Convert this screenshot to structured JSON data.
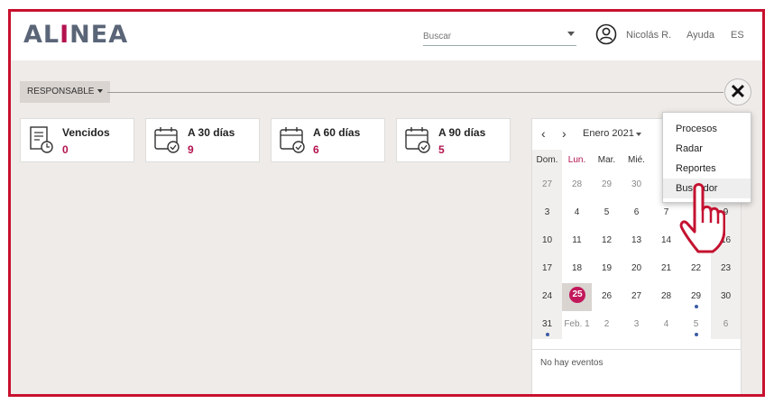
{
  "header": {
    "logo": {
      "part1": "AL",
      "part2": "I",
      "part3": "NEA"
    },
    "search_placeholder": "Buscar",
    "user_name": "Nicolás R.",
    "help": "Ayuda",
    "language": "ES"
  },
  "filter": {
    "label": "RESPONSABLE"
  },
  "close_label": "✕",
  "cards": [
    {
      "title": "Vencidos",
      "count": "0"
    },
    {
      "title": "A 30 días",
      "count": "9"
    },
    {
      "title": "A 60 días",
      "count": "6"
    },
    {
      "title": "A 90 días",
      "count": "5"
    }
  ],
  "calendar": {
    "prev": "‹",
    "next": "›",
    "month": "Enero 2021",
    "weekdays": [
      "Dom.",
      "Lun.",
      "Mar.",
      "Mié.",
      "",
      "",
      ""
    ],
    "weeks": [
      [
        "27",
        "28",
        "29",
        "30",
        "",
        "",
        ""
      ],
      [
        "3",
        "4",
        "5",
        "6",
        "7",
        "",
        "9"
      ],
      [
        "10",
        "11",
        "12",
        "13",
        "14",
        "",
        "16"
      ],
      [
        "17",
        "18",
        "19",
        "20",
        "21",
        "22",
        "23"
      ],
      [
        "24",
        "25",
        "26",
        "27",
        "28",
        "29",
        "30"
      ],
      [
        "31",
        "Feb. 1",
        "2",
        "3",
        "4",
        "5",
        "6"
      ]
    ],
    "today": "25",
    "no_events": "No hay eventos"
  },
  "menu": {
    "items": [
      "Procesos",
      "Radar",
      "Reportes",
      "Buscador"
    ],
    "active": "Buscador"
  },
  "colors": {
    "accent": "#b3124f",
    "frame": "#c8102e",
    "event_dot": "#3b5ba5"
  }
}
